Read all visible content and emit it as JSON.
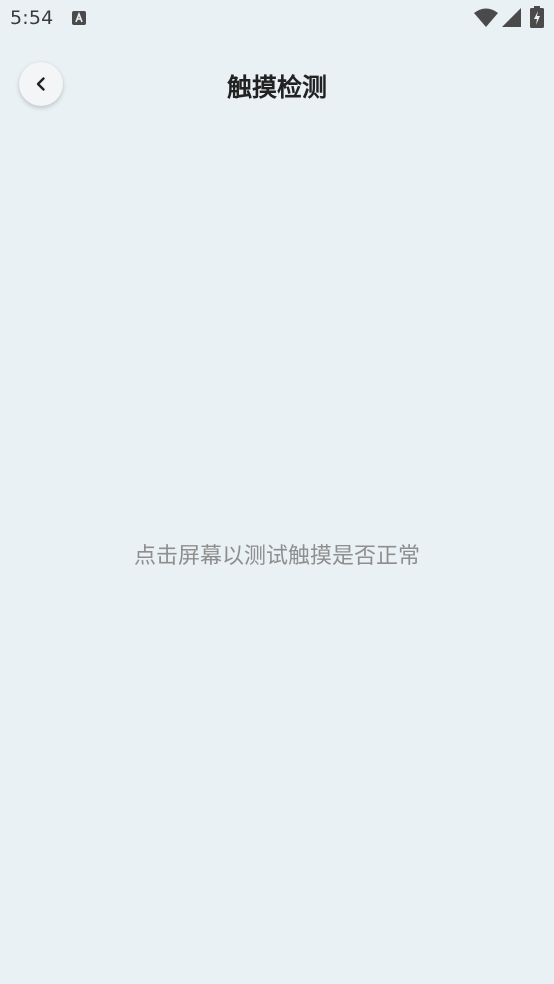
{
  "status_bar": {
    "time": "5:54",
    "notification_icon": "app-a-icon",
    "wifi_icon": "wifi-icon",
    "signal_icon": "signal-icon",
    "battery_icon": "battery-charging-icon"
  },
  "header": {
    "back_icon": "chevron-left-icon",
    "title": "触摸检测"
  },
  "main": {
    "hint": "点击屏幕以测试触摸是否正常"
  }
}
